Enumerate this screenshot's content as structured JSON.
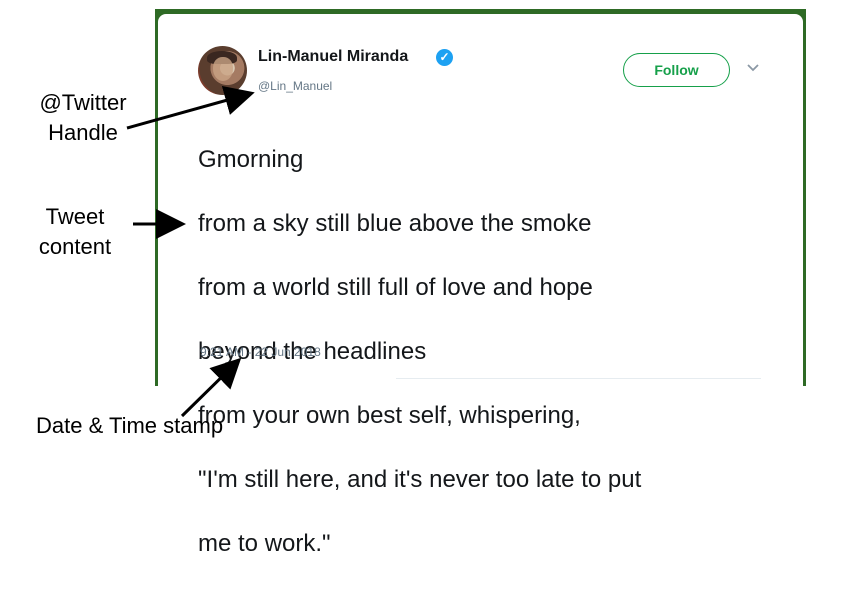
{
  "tweet": {
    "display_name": "Lin-Manuel Miranda",
    "verified_glyph": "✓",
    "handle": "@Lin_Manuel",
    "follow_label": "Follow",
    "lines": [
      "Gmorning",
      "from a sky still blue above the smoke",
      "from a world still full of love and hope",
      "beyond the headlines",
      "from your own best self, whispering,",
      "\"I'm still here, and it's never too late to put",
      "me to work.\""
    ],
    "timestamp": "9:21 AM - 22 Jun 2018"
  },
  "annotations": {
    "handle_line1": "@Twitter",
    "handle_line2": "Handle",
    "content_line1": "Tweet",
    "content_line2": "content",
    "date": "Date & Time stamp"
  },
  "icons": {
    "verified": "verified-check-icon",
    "menu": "chevron-down-icon",
    "avatar": "profile-photo"
  },
  "colors": {
    "follow_green": "#16a04a",
    "verified_blue": "#1da1f2",
    "muted_text": "#657786",
    "frame": "#2e6a25"
  }
}
